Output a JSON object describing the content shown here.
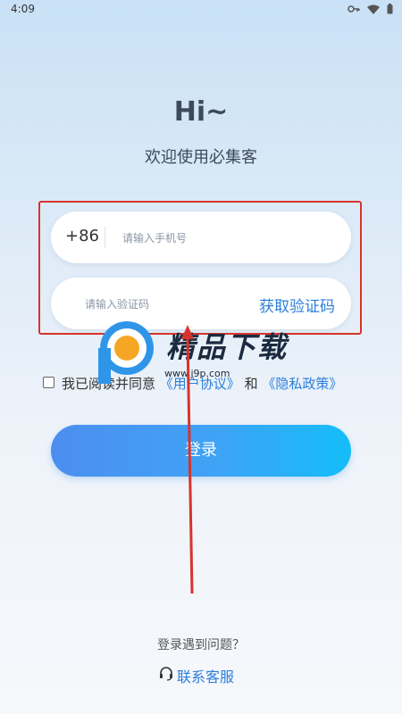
{
  "status_bar": {
    "time": "4:09"
  },
  "header": {
    "greeting": "Hi~",
    "subtitle": "欢迎使用必集客"
  },
  "phone_field": {
    "country_code": "+86",
    "placeholder": "请输入手机号"
  },
  "code_field": {
    "placeholder": "请输入验证码",
    "get_code_label": "获取验证码"
  },
  "agreement": {
    "prefix": "我已阅读并同意",
    "user_agreement": "《用户协议》",
    "conjunction": "和",
    "privacy_policy": "《隐私政策》"
  },
  "login_button": {
    "label": "登录"
  },
  "footer": {
    "problem_text": "登录遇到问题？",
    "support_label": "联系客服"
  },
  "watermark": {
    "text": "精品下载",
    "url": "www.j9p.com"
  },
  "colors": {
    "accent": "#2b7fdb",
    "highlight_box": "#d7332d",
    "button_start": "#4c8ef0",
    "button_end": "#14bdf8"
  }
}
